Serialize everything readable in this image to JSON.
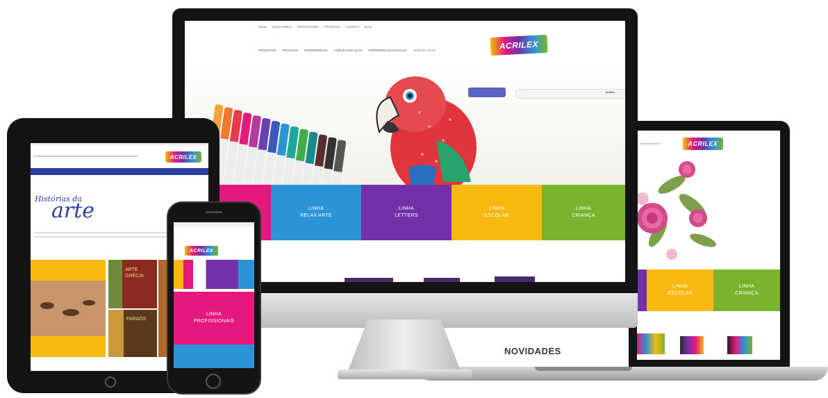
{
  "brand": {
    "logo": "ACRILEX"
  },
  "desktop": {
    "top_links": [
      "HOME",
      "QUEM SOMOS",
      "PROFISSIONAIS",
      "PRODUTOS",
      "CONTATO",
      "BLOG"
    ],
    "main_nav": [
      "PRODUTOS",
      "TÉCNICAS",
      "EXPERIÊNCIAS",
      "ACRILEX EM AÇÃO",
      "EXPERIÊNCIAS MÁGICAS",
      "ACRILEX ARTE"
    ],
    "pen_brand": "acrilex",
    "tiles": [
      {
        "line1": "LINHA",
        "line2": "RELAX ARTE",
        "color": "#2a94d6"
      },
      {
        "line1": "LINHA",
        "line2": "LETTERS",
        "color": "#7430a8"
      },
      {
        "line1": "LINHA",
        "line2": "ESCOLAR",
        "color": "#f7b90f"
      },
      {
        "line1": "LINHA",
        "line2": "CRIANÇA",
        "color": "#7ab42e"
      }
    ],
    "magenta": "#e5187e"
  },
  "tablet": {
    "heading_top": "Histórias da",
    "heading_main": "arte",
    "cards": [
      "ARTE GRÉCIA",
      "FARAÓS"
    ]
  },
  "phone": {
    "tile_line1": "LINHA",
    "tile_line2": "PROFISSIONAIS"
  },
  "laptop": {
    "section_title": "NOVIDADES",
    "tiles": [
      {
        "line1": "LINHA",
        "line2": "ESCOLAR",
        "color": "#f7b90f"
      },
      {
        "line1": "LINHA",
        "line2": "CRIANÇA",
        "color": "#7ab42e"
      }
    ]
  }
}
